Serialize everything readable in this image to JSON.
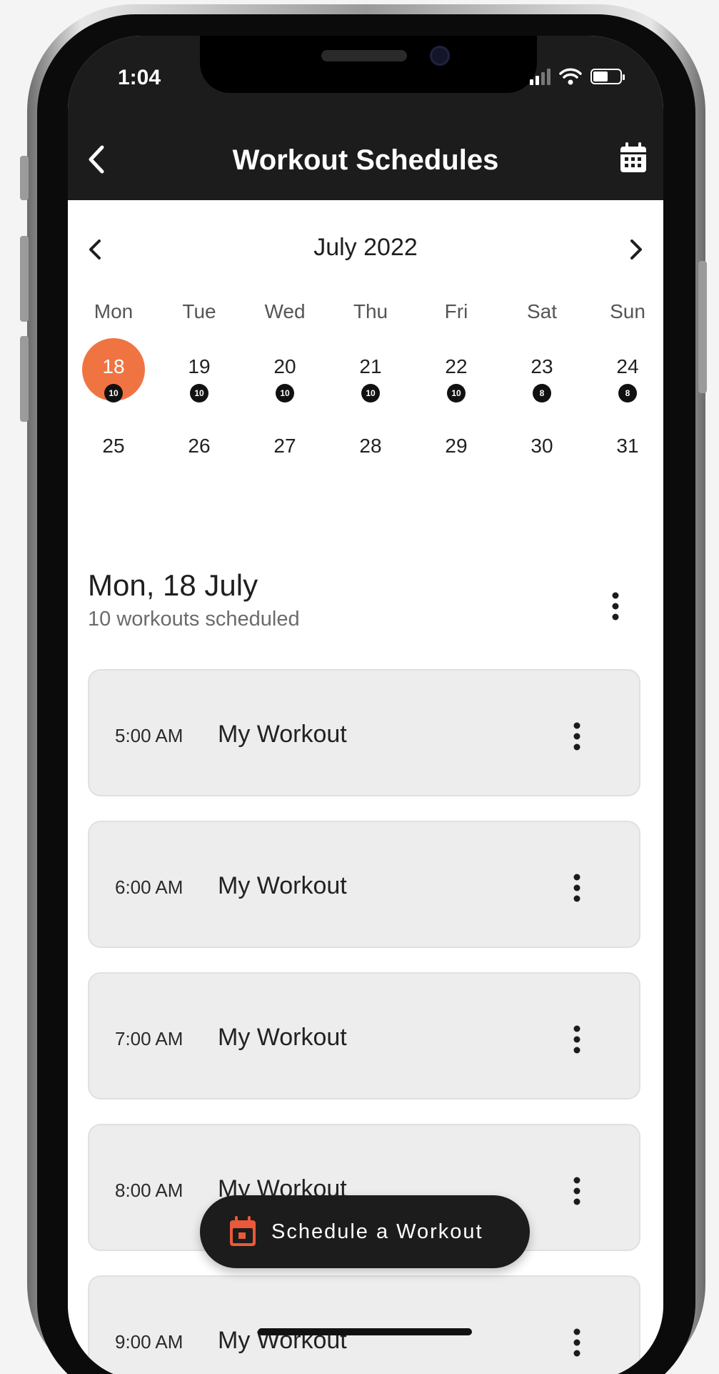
{
  "status_bar": {
    "time": "1:04"
  },
  "header": {
    "title": "Workout Schedules"
  },
  "calendar": {
    "month_label": "July 2022",
    "weekdays": [
      "Mon",
      "Tue",
      "Wed",
      "Thu",
      "Fri",
      "Sat",
      "Sun"
    ],
    "weeks": [
      [
        {
          "day": "18",
          "count": "10",
          "selected": true
        },
        {
          "day": "19",
          "count": "10"
        },
        {
          "day": "20",
          "count": "10"
        },
        {
          "day": "21",
          "count": "10"
        },
        {
          "day": "22",
          "count": "10"
        },
        {
          "day": "23",
          "count": "8"
        },
        {
          "day": "24",
          "count": "8"
        }
      ],
      [
        {
          "day": "25"
        },
        {
          "day": "26"
        },
        {
          "day": "27"
        },
        {
          "day": "28"
        },
        {
          "day": "29"
        },
        {
          "day": "30"
        },
        {
          "day": "31"
        }
      ]
    ],
    "accent_color": "#f07442"
  },
  "day_summary": {
    "title": "Mon, 18 July",
    "subtitle": "10 workouts scheduled"
  },
  "workouts": [
    {
      "time": "5:00 AM",
      "name": "My Workout"
    },
    {
      "time": "6:00 AM",
      "name": "My Workout"
    },
    {
      "time": "7:00 AM",
      "name": "My Workout"
    },
    {
      "time": "8:00 AM",
      "name": "My Workout"
    },
    {
      "time": "9:00 AM",
      "name": "My Workout"
    }
  ],
  "fab": {
    "label": "Schedule a Workout",
    "icon": "calendar-icon",
    "icon_color": "#e9593a"
  }
}
